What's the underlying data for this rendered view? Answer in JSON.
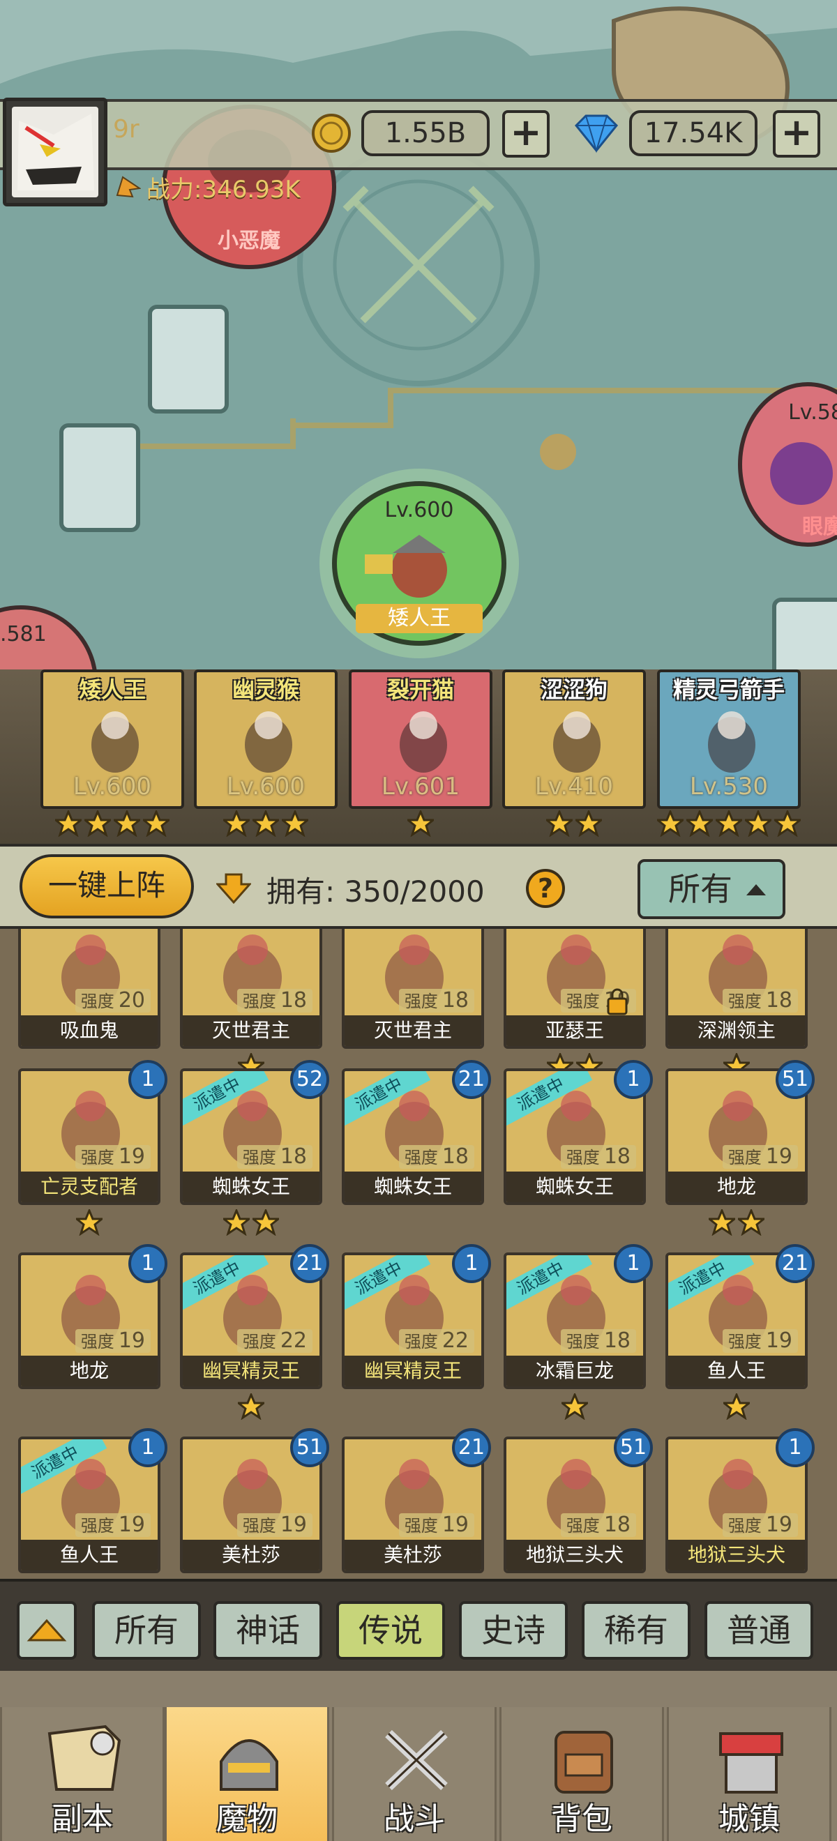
{
  "header": {
    "player_name": "9r",
    "power_label": "战力:346.93K",
    "gold": "1.55B",
    "gems": "17.54K",
    "plus": "+"
  },
  "map": {
    "node_top_left_label": "小恶魔",
    "node_right_level": "Lv.58",
    "node_right_label": "眼魔",
    "node_center_level": "Lv.600",
    "node_center_label": "矮人王",
    "node_left_level": ".581"
  },
  "team": [
    {
      "name": "矮人王",
      "level": "Lv.600",
      "stars": 4,
      "bg": "#d6b45e",
      "name_color": "#f4e57a"
    },
    {
      "name": "幽灵猴",
      "level": "Lv.600",
      "stars": 3,
      "bg": "#d6b45e",
      "name_color": "#f4e57a"
    },
    {
      "name": "裂开猫",
      "level": "Lv.601",
      "stars": 1,
      "bg": "#d86a6f",
      "name_color": "#f4e57a"
    },
    {
      "name": "涩涩狗",
      "level": "Lv.410",
      "stars": 2,
      "bg": "#d6b45e",
      "name_color": "#ffffff"
    },
    {
      "name": "精灵弓箭手",
      "level": "Lv.530",
      "stars": 5,
      "bg": "#6ba7bd",
      "name_color": "#ffffff"
    }
  ],
  "controls": {
    "deploy_label": "一键上阵",
    "own_label": "拥有: 350/2000",
    "help": "?",
    "filter_label": "所有"
  },
  "collection": [
    {
      "name": "吸血鬼",
      "strength": "20",
      "stars": 0,
      "count": "",
      "dispatch": false,
      "gold_name": false
    },
    {
      "name": "灭世君主",
      "strength": "18",
      "stars": 1,
      "count": "",
      "dispatch": false,
      "gold_name": false
    },
    {
      "name": "灭世君主",
      "strength": "18",
      "stars": 0,
      "count": "",
      "dispatch": false,
      "gold_name": false
    },
    {
      "name": "亚瑟王",
      "strength": "19",
      "stars": 2,
      "count": "",
      "dispatch": false,
      "gold_name": false,
      "locked": true
    },
    {
      "name": "深渊领主",
      "strength": "18",
      "stars": 1,
      "count": "",
      "dispatch": false,
      "gold_name": false
    },
    {
      "name": "亡灵支配者",
      "strength": "19",
      "stars": 1,
      "count": "1",
      "dispatch": false,
      "gold_name": true
    },
    {
      "name": "蜘蛛女王",
      "strength": "18",
      "stars": 2,
      "count": "52",
      "dispatch": true,
      "gold_name": false
    },
    {
      "name": "蜘蛛女王",
      "strength": "18",
      "stars": 0,
      "count": "21",
      "dispatch": true,
      "gold_name": false
    },
    {
      "name": "蜘蛛女王",
      "strength": "18",
      "stars": 0,
      "count": "1",
      "dispatch": true,
      "gold_name": false
    },
    {
      "name": "地龙",
      "strength": "19",
      "stars": 2,
      "count": "51",
      "dispatch": false,
      "gold_name": false
    },
    {
      "name": "地龙",
      "strength": "19",
      "stars": 0,
      "count": "1",
      "dispatch": false,
      "gold_name": false
    },
    {
      "name": "幽冥精灵王",
      "strength": "22",
      "stars": 1,
      "count": "21",
      "dispatch": true,
      "gold_name": true
    },
    {
      "name": "幽冥精灵王",
      "strength": "22",
      "stars": 0,
      "count": "1",
      "dispatch": true,
      "gold_name": true
    },
    {
      "name": "冰霜巨龙",
      "strength": "18",
      "stars": 1,
      "count": "1",
      "dispatch": true,
      "gold_name": false
    },
    {
      "name": "鱼人王",
      "strength": "19",
      "stars": 1,
      "count": "21",
      "dispatch": true,
      "gold_name": false
    },
    {
      "name": "鱼人王",
      "strength": "19",
      "stars": 0,
      "count": "1",
      "dispatch": true,
      "gold_name": false
    },
    {
      "name": "美杜莎",
      "strength": "19",
      "stars": 0,
      "count": "51",
      "dispatch": false,
      "gold_name": false
    },
    {
      "name": "美杜莎",
      "strength": "19",
      "stars": 0,
      "count": "21",
      "dispatch": false,
      "gold_name": false
    },
    {
      "name": "地狱三头犬",
      "strength": "18",
      "stars": 0,
      "count": "51",
      "dispatch": false,
      "gold_name": false
    },
    {
      "name": "地狱三头犬",
      "strength": "19",
      "stars": 0,
      "count": "1",
      "dispatch": false,
      "gold_name": true
    }
  ],
  "card_labels": {
    "strength_prefix": "强度",
    "dispatch_text": "派遣中"
  },
  "rarity_tabs": [
    "所有",
    "神话",
    "传说",
    "史诗",
    "稀有",
    "普通"
  ],
  "rarity_active": "传说",
  "nav": [
    {
      "label": "副本",
      "icon": "map-scroll-icon"
    },
    {
      "label": "魔物",
      "icon": "knight-helmet-icon"
    },
    {
      "label": "战斗",
      "icon": "crossed-swords-icon"
    },
    {
      "label": "背包",
      "icon": "backpack-icon"
    },
    {
      "label": "城镇",
      "icon": "shop-building-icon"
    }
  ],
  "nav_active": "魔物",
  "colors": {
    "accent_gold": "#f0a91e",
    "map_teal": "#7ea59f",
    "count_blue": "#2b72b8",
    "dispatch_cyan": "#5fd6d0"
  }
}
